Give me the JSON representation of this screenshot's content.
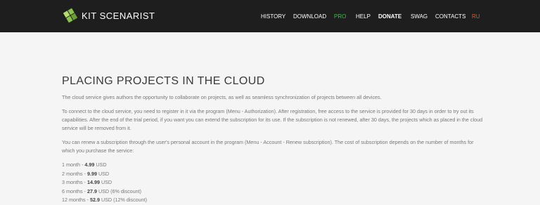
{
  "header": {
    "brand": "KIT SCENARIST",
    "nav": [
      {
        "label": "HISTORY"
      },
      {
        "label": "DOWNLOAD"
      },
      {
        "label": "PRO"
      },
      {
        "label": "HELP"
      },
      {
        "label": "DONATE"
      },
      {
        "label": "SWAG"
      },
      {
        "label": "CONTACTS"
      },
      {
        "label": "RU"
      }
    ],
    "colors": {
      "background": "#1e1e1e",
      "pro": "#2fc24a",
      "lang": "#e05a1a"
    }
  },
  "main": {
    "title": "PLACING PROJECTS IN THE CLOUD",
    "paragraphs": [
      "The cloud service gives authors the opportunity to collaborate on projects, as well as seamless synchronization of projects between all devices.",
      "To connect to the cloud service, you need to register in it via the program (Menu - Authorization). After registration, free access to the service is provided for 30 days in order to try out its capabilities. After the end of the trial period, if you want you can extend the subscription for its use. If the subscription is not renewed, after 30 days, the projects which as placed in the cloud service will be removed from it.",
      "You can renew a subscription through the user's personal account in the program (Menu - Account - Renew subscription). The cost of subscription depends on the number of months for which you purchase the service:"
    ],
    "prices": [
      {
        "period": "1 month - ",
        "amount": "4.99",
        "suffix": " USD"
      },
      {
        "period": "2 months - ",
        "amount": "9.99",
        "suffix": " USD"
      },
      {
        "period": "3 months - ",
        "amount": "14.99",
        "suffix": " USD"
      },
      {
        "period": "6 months - ",
        "amount": "27.9",
        "suffix": " USD (6% discount)"
      },
      {
        "period": "12 months - ",
        "amount": "52.9",
        "suffix": " USD (12% discount)"
      }
    ]
  }
}
